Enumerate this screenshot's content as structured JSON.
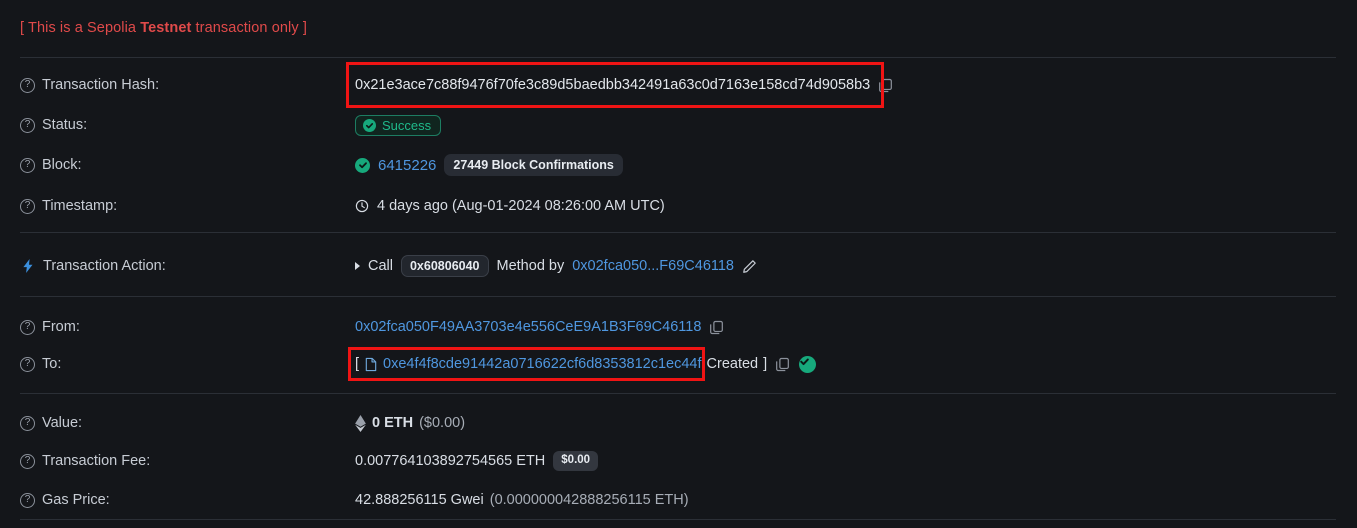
{
  "banner": {
    "prefix": "[ This is a Sepolia ",
    "strong": "Testnet",
    "suffix": " transaction only ]"
  },
  "labels": {
    "transaction_hash": "Transaction Hash:",
    "status": "Status:",
    "block": "Block:",
    "timestamp": "Timestamp:",
    "transaction_action": "Transaction Action:",
    "from": "From:",
    "to": "To:",
    "value": "Value:",
    "transaction_fee": "Transaction Fee:",
    "gas_price": "Gas Price:"
  },
  "values": {
    "transaction_hash": "0x21e3ace7c88f9476f70fe3c89d5baedbb342491a63c0d7163e158cd74d9058b3",
    "status": "Success",
    "block_number": "6415226",
    "block_confirmations": "27449 Block Confirmations",
    "timestamp": "4 days ago (Aug-01-2024 08:26:00 AM UTC)",
    "action_call": "Call",
    "action_method_id": "0x60806040",
    "action_method_by": "Method by",
    "action_address": "0x02fca050...F69C46118",
    "from_address": "0x02fca050F49AA3703e4e556CeE9A1B3F69C46118",
    "to_bracket_open": "[",
    "to_address": "0xe4f4f8cde91442a0716622cf6d8353812c1ec44f",
    "to_created": "Created",
    "to_bracket_close": "]",
    "value_eth": "0 ETH",
    "value_usd": "($0.00)",
    "fee_eth": "0.007764103892754565 ETH",
    "fee_usd": "$0.00",
    "gas_price_gwei": "42.888256115 Gwei",
    "gas_price_eth": "(0.000000042888256115 ETH)"
  },
  "icons": {
    "help": "question-mark-circle-icon",
    "action": "lightning-bolt-icon",
    "copy": "copy-icon",
    "clock": "clock-icon",
    "document": "document-icon",
    "pencil": "pencil-edit-icon",
    "ethereum": "ethereum-diamond-icon",
    "check": "check-circle-icon"
  },
  "colors": {
    "background": "#14161a",
    "link": "#4f97e0",
    "success": "#1fb98a",
    "warning_red": "#e04a4a",
    "highlight_box": "#f01414",
    "text": "#d9dee5",
    "label": "#c7ccd4",
    "divider": "#2b2f36"
  }
}
